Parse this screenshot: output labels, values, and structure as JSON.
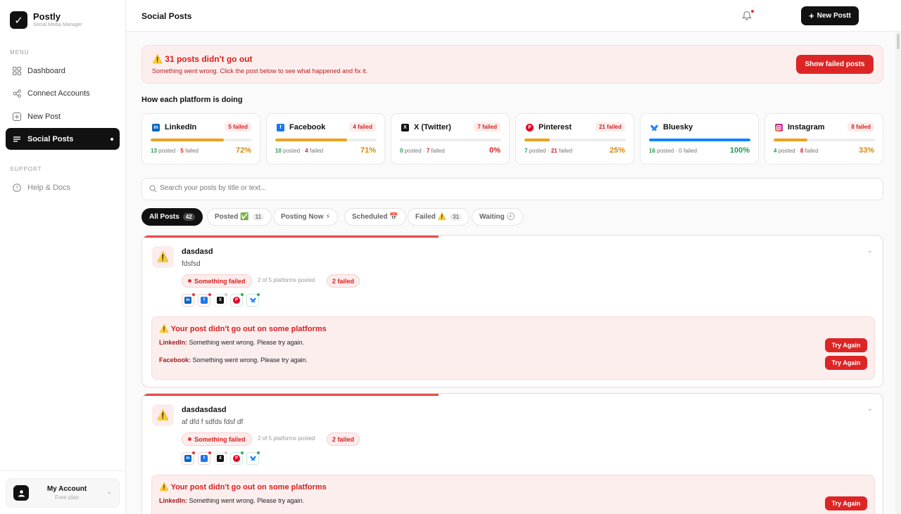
{
  "brand": {
    "name": "Postly",
    "subtitle": "Social Media Manager"
  },
  "sidebar": {
    "menu_label": "MENU",
    "support_label": "SUPPORT",
    "items": [
      {
        "label": "Dashboard",
        "icon": "grid-icon"
      },
      {
        "label": "Connect Accounts",
        "icon": "share-icon"
      },
      {
        "label": "New Post",
        "icon": "plus-square-icon"
      },
      {
        "label": "Social Posts",
        "icon": "list-icon",
        "active": true
      }
    ],
    "support_items": [
      {
        "label": "Help & Docs",
        "icon": "help-circle-icon"
      }
    ],
    "account": {
      "name": "My Account",
      "plan": "Free plan"
    }
  },
  "header": {
    "title": "Social Posts",
    "new_post_label": "New Postt"
  },
  "alert": {
    "title": "31 posts didn't go out",
    "text": "Something went wrong. Click the post below to see what happened and fix it.",
    "button": "Show failed posts"
  },
  "platforms_title": "How each platform is doing",
  "platforms": [
    {
      "name": "LinkedIn",
      "badge": "5 failed",
      "posted": "13",
      "posted_label": "posted",
      "failed": "5",
      "failed_label": "failed",
      "pct": "72%",
      "pct_value": 72,
      "color": "#0a66c2",
      "bar_color": "#f0a020",
      "pct_color": "#d98a00",
      "glyph": "in"
    },
    {
      "name": "Facebook",
      "badge": "4 failed",
      "posted": "10",
      "posted_label": "posted",
      "failed": "4",
      "failed_label": "failed",
      "pct": "71%",
      "pct_value": 71,
      "color": "#1877f2",
      "bar_color": "#f0a020",
      "pct_color": "#d98a00",
      "glyph": "f"
    },
    {
      "name": "X (Twitter)",
      "badge": "7 failed",
      "posted": "0",
      "posted_label": "posted",
      "failed": "7",
      "failed_label": "failed",
      "pct": "0%",
      "pct_value": 0,
      "color": "#111111",
      "bar_color": "#e03434",
      "pct_color": "#d52020",
      "glyph": "X"
    },
    {
      "name": "Pinterest",
      "badge": "21 failed",
      "posted": "7",
      "posted_label": "posted",
      "failed": "21",
      "failed_label": "failed",
      "pct": "25%",
      "pct_value": 25,
      "color": "#e60023",
      "bar_color": "#f0a020",
      "pct_color": "#d98a00",
      "glyph": "P"
    },
    {
      "name": "Bluesky",
      "badge": "",
      "posted": "16",
      "posted_label": "posted",
      "failed": "0",
      "failed_label": "failed",
      "pct": "100%",
      "pct_value": 100,
      "color": "#1185fe",
      "bar_color": "#1185fe",
      "pct_color": "#1e9e4a",
      "glyph": "b"
    },
    {
      "name": "Instagram",
      "badge": "8 failed",
      "posted": "4",
      "posted_label": "posted",
      "failed": "8",
      "failed_label": "failed",
      "pct": "33%",
      "pct_value": 33,
      "color": "#d62976",
      "bar_color": "#f0a020",
      "pct_color": "#d98a00",
      "glyph": "ig"
    }
  ],
  "search": {
    "placeholder": "Search your posts by title or text..."
  },
  "tabs": [
    {
      "label": "All Posts",
      "count": "42",
      "active": true
    },
    {
      "label": "Posted ✅",
      "count": "11"
    },
    {
      "label": "Posting Now ⚡",
      "count": ""
    },
    {
      "label": "Scheduled 📅",
      "count": ""
    },
    {
      "label": "Failed ⚠️",
      "count": "31"
    },
    {
      "label": "Waiting 🕘",
      "count": ""
    }
  ],
  "posts": [
    {
      "title": "dasdasd",
      "body": "fdsfsd",
      "status": "Something failed",
      "progress_text": "2 of 5 platforms posted",
      "progress_fraction": 0.4,
      "failed_badge": "2 failed",
      "error_title": "Your post didn't go out on some platforms",
      "errors": [
        {
          "platform": "LinkedIn:",
          "message": "Something went wrong. Please try again.",
          "button": "Try Again"
        },
        {
          "platform": "Facebook:",
          "message": "Something went wrong. Please try again.",
          "button": "Try Again"
        }
      ]
    },
    {
      "title": "dasdasdasd",
      "body": "af dfd f sdfds fdsf df",
      "status": "Something failed",
      "progress_text": "2 of 5 platforms posted",
      "progress_fraction": 0.4,
      "failed_badge": "2 failed",
      "error_title": "Your post didn't go out on some platforms",
      "errors": [
        {
          "platform": "LinkedIn:",
          "message": "Something went wrong. Please try again.",
          "button": "Try Again"
        }
      ]
    }
  ]
}
